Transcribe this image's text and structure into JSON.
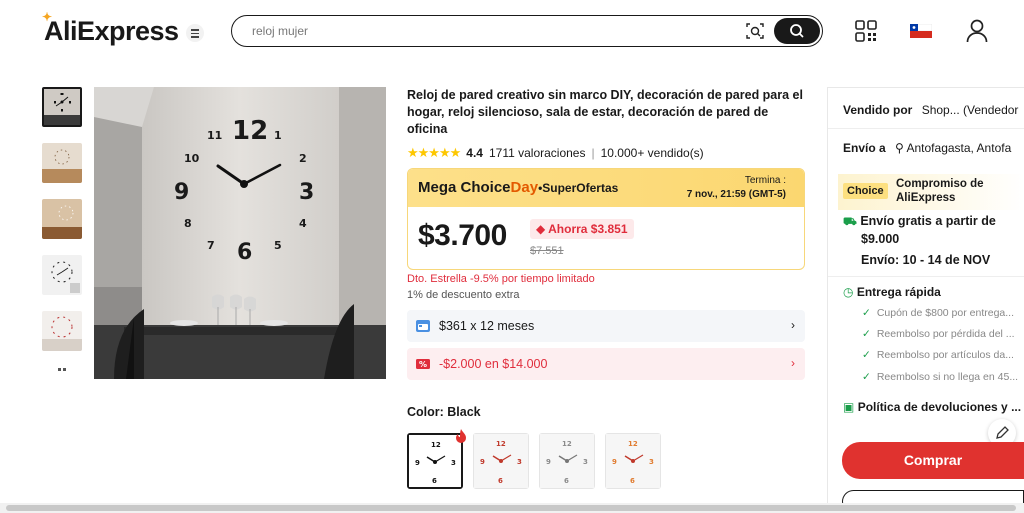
{
  "header": {
    "logo_text": "AliExpress",
    "search_placeholder": "reloj mujer"
  },
  "product": {
    "title": "Reloj de pared creativo sin marco DIY, decoración de pared para el hogar, reloj silencioso, sala de estar, decoración de pared de oficina",
    "rating": "4.4",
    "reviews": "1711 valoraciones",
    "sold": "10.000+ vendido(s)",
    "stars": "★★★★★"
  },
  "promo": {
    "name_a": "Mega Choice",
    "name_b": "Day",
    "name_c": "•SuperOfertas",
    "ends_label": "Termina :",
    "ends_date": "7 nov., 21:59 (GMT-5)",
    "price": "$3.700",
    "save": "Ahorra $3.851",
    "old_price": "$7.551"
  },
  "discounts": {
    "star": "Dto. Estrella -9.5% por tiempo limitado",
    "extra": "1% de descuento extra"
  },
  "installments": "$361 x 12 meses",
  "coupon": "-$2.000 en $14.000",
  "color": {
    "label": "Color: Black"
  },
  "right_panel": {
    "sold_by_label": "Vendido por",
    "sold_by_value": "Shop... (Vendedor",
    "ship_to_label": "Envío a",
    "ship_to_value": "Antofagasta, Antofa",
    "choice_badge": "Choice",
    "commitment_line1": "Compromiso de",
    "commitment_line2": "AliExpress",
    "free_ship_line1": "Envío gratis a partir de",
    "free_ship_line2": "$9.000",
    "delivery": "Envío: 10 - 14 de NOV",
    "fast_title": "Entrega rápida",
    "bullets": [
      "Cupón de $800 por entrega...",
      "Reembolso por pérdida del ...",
      "Reembolso por artículos da...",
      "Reembolso si no llega en 45..."
    ],
    "returns": "Política de devoluciones y ...",
    "buy_label": "Comprar"
  },
  "colors": {
    "brand_red": "#e0322f",
    "rating_star": "#fdc700",
    "promo_yellow": "#fde08a",
    "discount_red": "#e02d3c"
  }
}
